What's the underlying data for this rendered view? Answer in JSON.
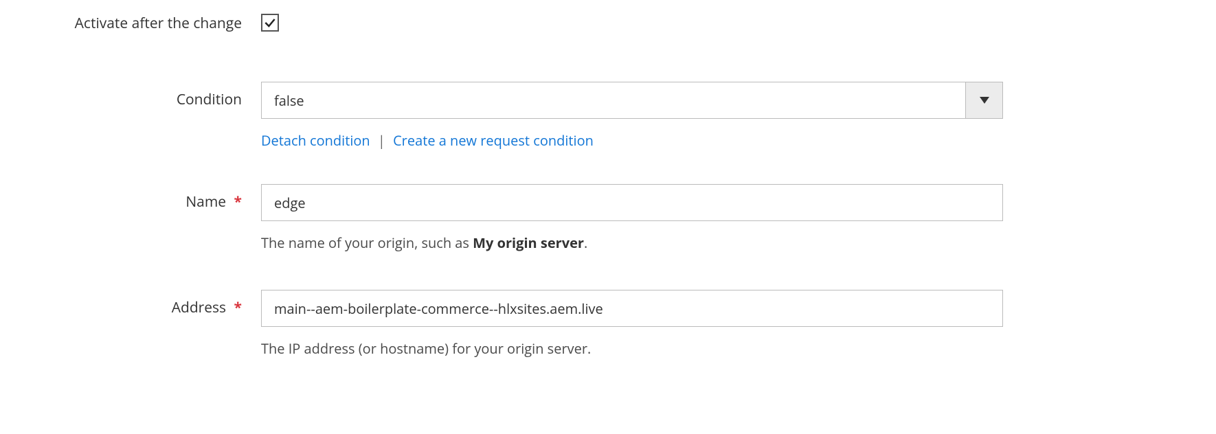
{
  "activate": {
    "label": "Activate after the change",
    "checked": true
  },
  "condition": {
    "label": "Condition",
    "value": "false",
    "detach_label": "Detach condition",
    "separator": "|",
    "create_label": "Create a new request condition"
  },
  "name": {
    "label": "Name",
    "value": "edge",
    "help_prefix": "The name of your origin, such as ",
    "help_bold": "My origin server",
    "help_suffix": "."
  },
  "address": {
    "label": "Address",
    "value": "main--aem-boilerplate-commerce--hlxsites.aem.live",
    "help": "The IP address (or hostname) for your origin server."
  }
}
